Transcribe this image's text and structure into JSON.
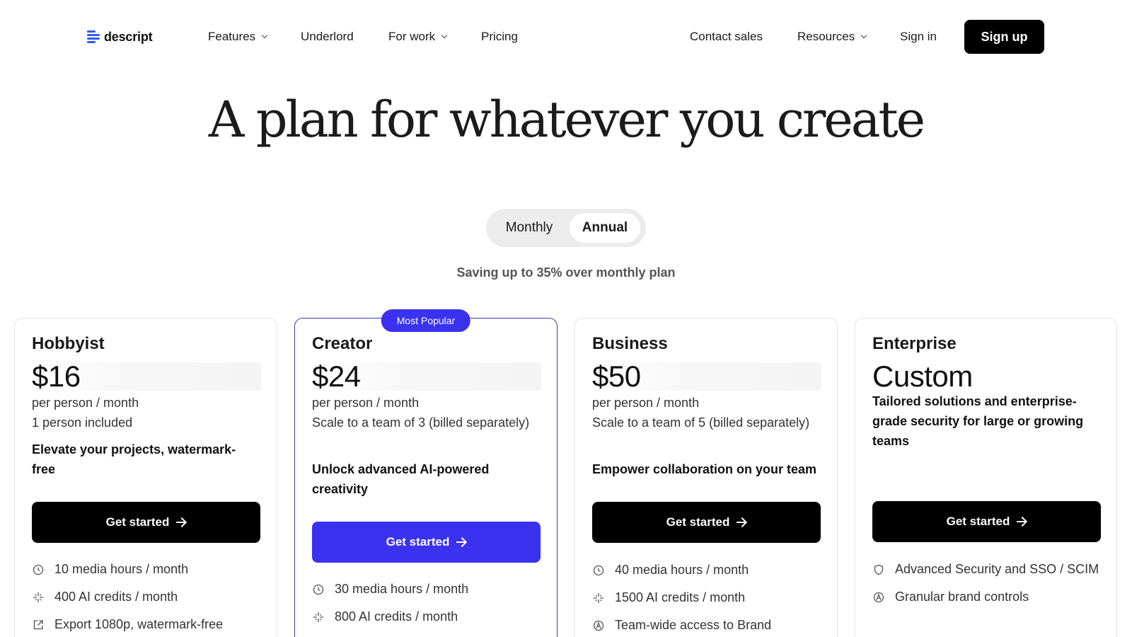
{
  "nav": {
    "logo_text": "descript",
    "features": "Features",
    "underlord": "Underlord",
    "for_work": "For work",
    "pricing": "Pricing",
    "contact_sales": "Contact sales",
    "resources": "Resources",
    "sign_in": "Sign in",
    "sign_up": "Sign up"
  },
  "hero": {
    "title": "A plan for whatever you create",
    "toggle_monthly": "Monthly",
    "toggle_annual": "Annual",
    "toggle_selected": "Annual",
    "saving": "Saving up to 35% over monthly plan"
  },
  "colors": {
    "accent": "#3b32f0",
    "logo_blue": "#2f5bff",
    "button_dark": "#000000"
  },
  "plans": [
    {
      "name": "Hobbyist",
      "price": "$16",
      "sub": "per person / month\n1 person included",
      "tagline": "Elevate your projects, watermark-free",
      "cta": "Get started",
      "features": [
        {
          "icon": "clock-icon",
          "text": "10 media hours / month"
        },
        {
          "icon": "sparkle-icon",
          "text": "400 AI credits / month"
        },
        {
          "icon": "export-icon",
          "text": "Export 1080p, watermark-free"
        }
      ]
    },
    {
      "name": "Creator",
      "badge": "Most Popular",
      "price": "$24",
      "sub": "per person / month\nScale to a team of 3 (billed separately)",
      "tagline": "Unlock advanced AI-powered creativity",
      "cta": "Get started",
      "features": [
        {
          "icon": "clock-icon",
          "text": "30 media hours / month"
        },
        {
          "icon": "sparkle-icon",
          "text": "800 AI credits / month"
        }
      ]
    },
    {
      "name": "Business",
      "price": "$50",
      "sub": "per person / month\nScale to a team of 5 (billed separately)",
      "tagline": "Empower collaboration on your team",
      "cta": "Get started",
      "features": [
        {
          "icon": "clock-icon",
          "text": "40 media hours / month"
        },
        {
          "icon": "sparkle-icon",
          "text": "1500 AI credits / month"
        },
        {
          "icon": "brand-icon",
          "text": "Team-wide access to Brand"
        }
      ]
    },
    {
      "name": "Enterprise",
      "price": "Custom",
      "tagline": "Tailored solutions and enterprise-grade security for large or growing teams",
      "cta": "Get started",
      "features": [
        {
          "icon": "shield-icon",
          "text": "Advanced Security and SSO / SCIM"
        },
        {
          "icon": "brand-icon",
          "text": "Granular brand controls"
        }
      ]
    }
  ]
}
